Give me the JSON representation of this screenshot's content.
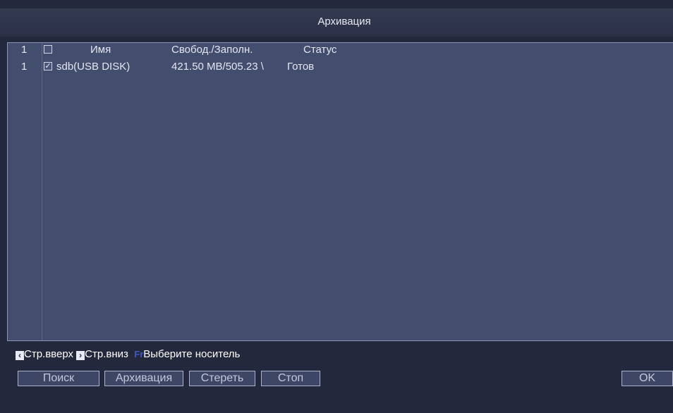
{
  "window": {
    "title": "Архивация"
  },
  "list": {
    "header": {
      "index": "1",
      "name": "Имя",
      "free_used": "Свобод./Заполн.",
      "status": "Статус"
    },
    "rows": [
      {
        "index": "1",
        "checked": true,
        "name": "sdb(USB DISK)",
        "free_used": "421.50 MB/505.23 \\",
        "status": "Готов"
      }
    ]
  },
  "footer": {
    "prev_icon": "‹",
    "prev_label": "Стр.вверх",
    "next_icon": "›",
    "next_label": "Стр.вниз",
    "fn_icon": "Fr",
    "fn_label": "Выберите носитель"
  },
  "buttons": {
    "search": "Поиск",
    "backup": "Архивация",
    "erase": "Стереть",
    "stop": "Стоп",
    "ok": "OK"
  },
  "icons": [
    "chevron-left-icon",
    "chevron-right-icon",
    "function-key-icon",
    "checkbox-icon"
  ],
  "colors": {
    "background": "#24283c",
    "list_bg": "#434d6e",
    "title_bg": "#2e3449",
    "fn_icon": "#3a58c6"
  }
}
